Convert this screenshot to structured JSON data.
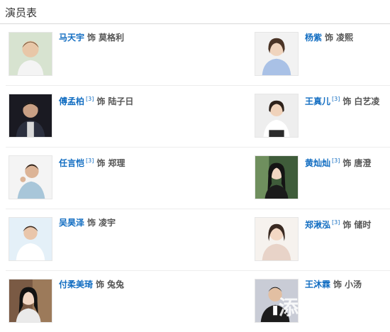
{
  "section": {
    "title": "演员表"
  },
  "cast": [
    {
      "actor": "马天宇",
      "sup": "",
      "as": "饰",
      "role": "莫格利",
      "photo_desc": "male-actor-portrait"
    },
    {
      "actor": "杨紫",
      "sup": "",
      "as": "饰",
      "role": "凌熙",
      "photo_desc": "female-actor-portrait"
    },
    {
      "actor": "傅孟柏",
      "sup": "[3]",
      "as": "饰",
      "role": "陆子日",
      "photo_desc": "male-actor-portrait"
    },
    {
      "actor": "王真儿",
      "sup": "[3]",
      "as": "饰",
      "role": "白艺凌",
      "photo_desc": "female-actor-portrait"
    },
    {
      "actor": "任言恺",
      "sup": "[3]",
      "as": "饰",
      "role": "郑理",
      "photo_desc": "male-actor-portrait"
    },
    {
      "actor": "黄灿灿",
      "sup": "[3]",
      "as": "饰",
      "role": "唐澄",
      "photo_desc": "female-actor-portrait"
    },
    {
      "actor": "吴昊泽",
      "sup": "",
      "as": "饰",
      "role": "凌宇",
      "photo_desc": "male-actor-portrait"
    },
    {
      "actor": "郑湫泓",
      "sup": "[3]",
      "as": "饰",
      "role": "储时",
      "photo_desc": "female-actor-portrait"
    },
    {
      "actor": "付柔美琦",
      "sup": "",
      "as": "饰",
      "role": "兔兔",
      "photo_desc": "female-actor-portrait"
    },
    {
      "actor": "王沐霖",
      "sup": "",
      "as": "饰",
      "role": "小汤",
      "photo_desc": "male-actor-portrait"
    }
  ],
  "watermark": "添"
}
